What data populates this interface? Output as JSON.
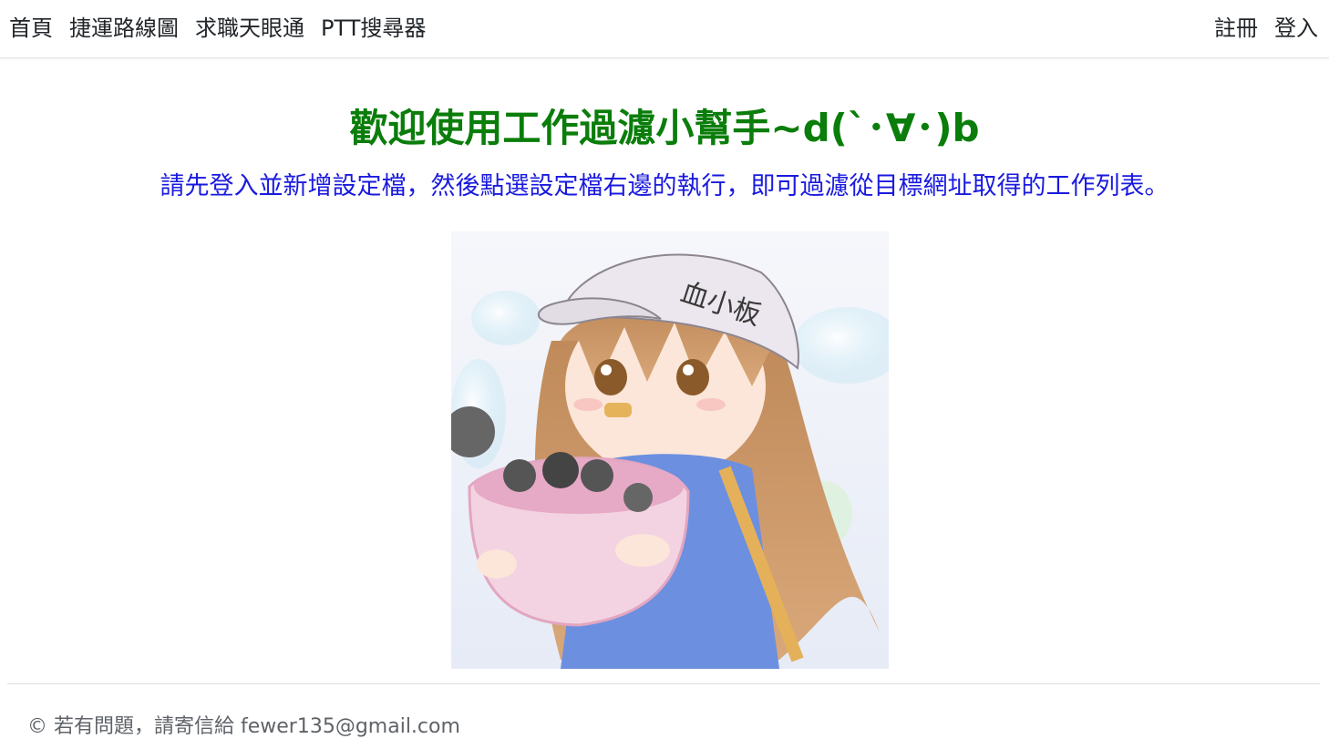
{
  "nav": {
    "left": [
      "首頁",
      "捷運路線圖",
      "求職天眼通",
      "PTT搜尋器"
    ],
    "right": [
      "註冊",
      "登入"
    ]
  },
  "main": {
    "title": "歡迎使用工作過濾小幫手~d(`･∀･)b",
    "subtitle": "請先登入並新增設定檔，然後點選設定檔右邊的執行，即可過濾從目標網址取得的工作列表。",
    "hero_image": {
      "hat_text": "血小板"
    }
  },
  "footer": {
    "text": "© 若有問題，請寄信給 fewer135@gmail.com"
  },
  "colors": {
    "title": "#0a7d0a",
    "subtitle": "#1a1adf",
    "nav_text": "#212529",
    "footer_text": "#5f6368"
  }
}
